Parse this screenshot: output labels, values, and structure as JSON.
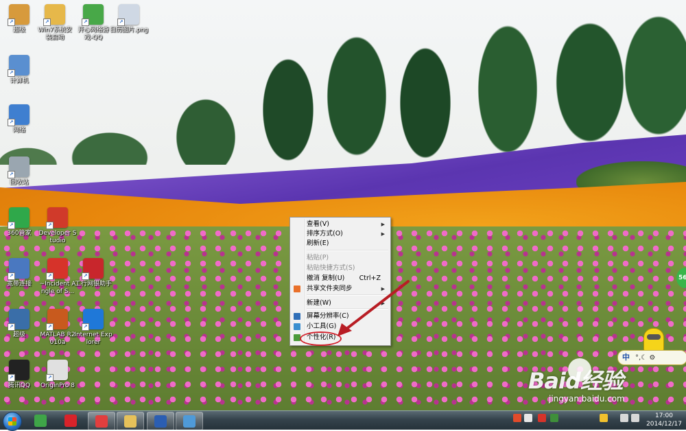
{
  "desktop": {
    "icons": [
      {
        "label": "超级",
        "icon": "user-folder-icon",
        "color": "#d79a3c"
      },
      {
        "label": "Win7系统安装启动",
        "icon": "folder-icon",
        "color": "#e6b84a"
      },
      {
        "label": "开心网络游戏-QQ",
        "icon": "qq-game-icon",
        "color": "#48a848"
      },
      {
        "label": "日历图片.png",
        "icon": "image-file-icon",
        "color": "#cfd8e4"
      },
      {
        "label": "计算机",
        "icon": "computer-icon",
        "color": "#5a8fd0"
      },
      {
        "label": "网络",
        "icon": "network-icon",
        "color": "#3f7fd0"
      },
      {
        "label": "回收站",
        "icon": "recycle-bin-icon",
        "color": "#9aa6b0"
      },
      {
        "label": "360管家",
        "icon": "360-safeguard-icon",
        "color": "#2fa84a"
      },
      {
        "label": "Developer Studio",
        "icon": "developer-studio-icon",
        "color": "#d03a2a"
      },
      {
        "label": "宽带连接",
        "icon": "broadband-icon",
        "color": "#4a78c0"
      },
      {
        "label": "~Incident Angle of S...",
        "icon": "pdf-icon",
        "color": "#d6332a"
      },
      {
        "label": "工行网银助手",
        "icon": "icbc-icon",
        "color": "#c8262c"
      },
      {
        "label": "超级",
        "icon": "app-icon",
        "color": "#3a6ea8"
      },
      {
        "label": "MATLAB R2010a",
        "icon": "matlab-icon",
        "color": "#c85a1e"
      },
      {
        "label": "Internet Explorer",
        "icon": "ie-icon",
        "color": "#1f78d8"
      },
      {
        "label": "腾讯QQ",
        "icon": "qq-icon",
        "color": "#222222"
      },
      {
        "label": "OriginPro 8",
        "icon": "originpro-icon",
        "color": "#e0e0e0"
      }
    ]
  },
  "context_menu": {
    "items": [
      {
        "label": "查看(V)",
        "submenu": true,
        "disabled": false
      },
      {
        "label": "排序方式(O)",
        "submenu": true,
        "disabled": false
      },
      {
        "label": "刷新(E)",
        "submenu": false,
        "disabled": false
      },
      {
        "label": "粘贴(P)",
        "submenu": false,
        "disabled": true
      },
      {
        "label": "粘贴快捷方式(S)",
        "submenu": false,
        "disabled": true
      },
      {
        "label": "撤消 复制(U)",
        "shortcut": "Ctrl+Z",
        "submenu": false,
        "disabled": false
      },
      {
        "label": "共享文件夹同步",
        "submenu": true,
        "disabled": false,
        "icon": "sync-icon"
      },
      {
        "label": "新建(W)",
        "submenu": true,
        "disabled": false
      },
      {
        "label": "屏幕分辨率(C)",
        "submenu": false,
        "disabled": false,
        "icon": "screen-resolution-icon"
      },
      {
        "label": "小工具(G)",
        "submenu": false,
        "disabled": false,
        "icon": "gadgets-icon"
      },
      {
        "label": "个性化(R)",
        "submenu": false,
        "disabled": false,
        "icon": "personalize-icon"
      }
    ]
  },
  "floating_badge": "56",
  "ime_bar": {
    "mode": "中",
    "symbols": "°,☾ ⚙"
  },
  "watermark": {
    "logo": "Baid经验",
    "site": "jingyan.baidu.com"
  },
  "taskbar": {
    "buttons": [
      {
        "icon": "360-browser-icon",
        "color": "#3fa548"
      },
      {
        "icon": "baofeng-player-icon",
        "color": "#d8232a"
      },
      {
        "icon": "google-chrome-icon",
        "color": "#e23e3e"
      },
      {
        "icon": "windows-explorer-icon",
        "color": "#e6c15a"
      },
      {
        "icon": "word-icon",
        "color": "#2b5eb2"
      },
      {
        "icon": "control-panel-icon",
        "color": "#4f9ad8"
      }
    ],
    "tray_icons": [
      {
        "icon": "sogou-icon",
        "color": "#e24b2a"
      },
      {
        "icon": "battery-icon",
        "color": "#e7e7e7"
      },
      {
        "icon": "flash-icon",
        "color": "#d6332a"
      },
      {
        "icon": "thunder-icon",
        "color": "#3f8f3a"
      },
      {
        "icon": "qq-tray-icon",
        "color": "#f2c12e"
      },
      {
        "icon": "network-tray-icon",
        "color": "#d8d8d8"
      },
      {
        "icon": "volume-icon",
        "color": "#d8d8d8"
      }
    ],
    "clock_time": "17:00",
    "clock_date": "2014/12/17"
  }
}
